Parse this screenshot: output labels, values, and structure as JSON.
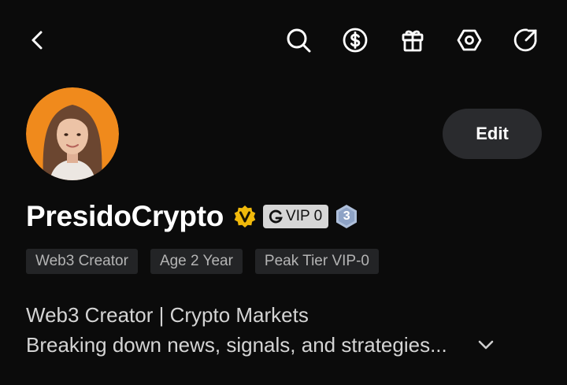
{
  "header": {
    "icons": [
      "back-icon",
      "search-icon",
      "dollar-icon",
      "gift-icon",
      "settings-icon",
      "share-icon"
    ]
  },
  "profile": {
    "username": "PresidoCrypto",
    "verified_icon": "verified-v-icon",
    "vip_label": "VIP 0",
    "level": "3",
    "edit_label": "Edit",
    "tags": [
      "Web3 Creator",
      "Age 2 Year",
      "Peak Tier VIP-0"
    ],
    "bio": {
      "line1": "Web3 Creator | Crypto Markets",
      "line2": "Breaking down news, signals, and strategies..."
    }
  },
  "colors": {
    "background": "#0b0b0b",
    "verified": "#f0b90b",
    "edit_button": "#2a2b2e",
    "tag_bg": "#232426",
    "avatar_bg": "#f08a1c"
  }
}
